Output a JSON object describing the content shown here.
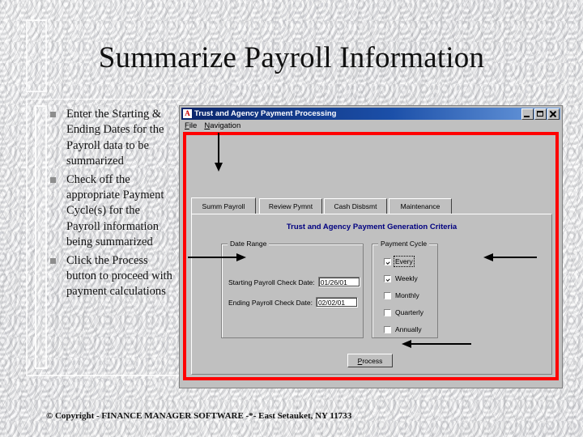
{
  "slide": {
    "title": "Summarize Payroll Information",
    "bullets": [
      "Enter the Starting & Ending Dates for the Payroll data to be summarized",
      "Check off the appropriate Payment Cycle(s) for the Payroll information being summarized",
      "Click the Process button to proceed with payment calculations"
    ],
    "footer": "© Copyright - FINANCE MANAGER SOFTWARE -*- East Setauket, NY 11733"
  },
  "app": {
    "icon_glyph": "A",
    "title": "Trust and Agency Payment Processing",
    "window_buttons": [
      {
        "name": "minimize-button",
        "label": "_"
      },
      {
        "name": "maximize-button",
        "label": "□"
      },
      {
        "name": "close-button",
        "label": "✕"
      }
    ],
    "menus": [
      {
        "label": "File",
        "accel": "F"
      },
      {
        "label": "Navigation",
        "accel": "N"
      }
    ],
    "tabs": [
      {
        "label": "Summ Payroll",
        "selected": true
      },
      {
        "label": "Review Pymnt",
        "selected": false
      },
      {
        "label": "Cash Disbsmt",
        "selected": false
      },
      {
        "label": "Maintenance",
        "selected": false
      }
    ],
    "panel_title": "Trust and Agency Payment Generation Criteria",
    "date_range": {
      "group_label": "Date Range",
      "fields": [
        {
          "label": "Starting Payroll Check Date:",
          "value": "01/26/01"
        },
        {
          "label": "Ending Payroll Check Date:",
          "value": "02/02/01"
        }
      ]
    },
    "payment_cycle": {
      "group_label": "Payment Cycle",
      "options": [
        {
          "label": "Every",
          "checked": true,
          "focused": true
        },
        {
          "label": "Weekly",
          "checked": true,
          "focused": false
        },
        {
          "label": "Monthly",
          "checked": false,
          "focused": false
        },
        {
          "label": "Quarterly",
          "checked": false,
          "focused": false
        },
        {
          "label": "Annually",
          "checked": false,
          "focused": false
        }
      ]
    },
    "process_button": {
      "label": "Process",
      "accel": "P"
    }
  },
  "colors": {
    "highlight_border": "#ff0000",
    "titlebar_start": "#0a246a",
    "titlebar_end": "#6f9fe0",
    "panel_title": "#000080",
    "face": "#c0c0c0"
  }
}
